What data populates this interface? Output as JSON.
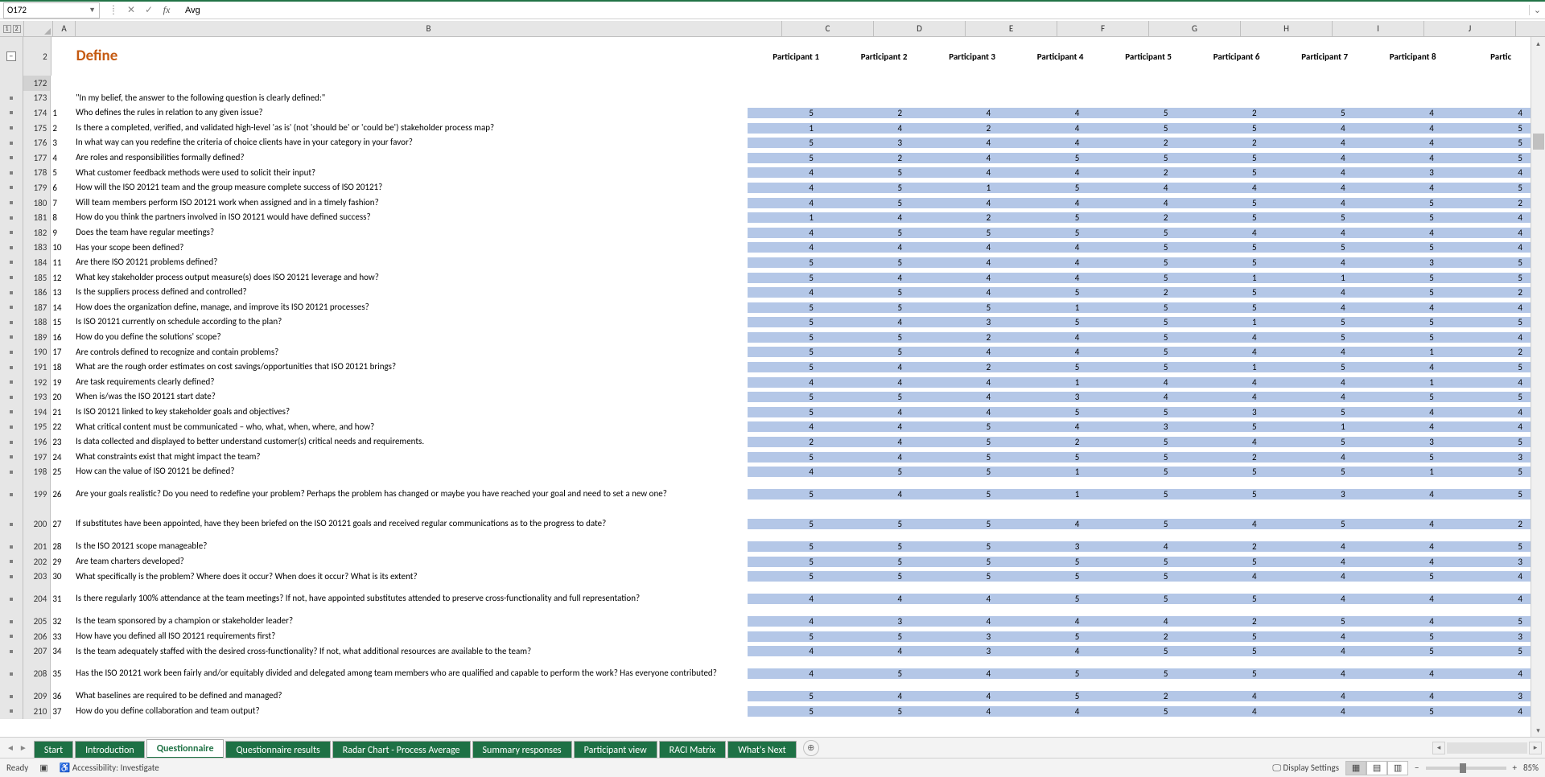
{
  "formula_bar": {
    "namebox": "O172",
    "formula": "Avg"
  },
  "outline_levels": [
    "1",
    "2"
  ],
  "columns": [
    "A",
    "B",
    "C",
    "D",
    "E",
    "F",
    "G",
    "H",
    "I",
    "J"
  ],
  "title_row": {
    "row_num": "2",
    "title": "Define",
    "participants": [
      "Participant 1",
      "Participant 2",
      "Participant 3",
      "Participant 4",
      "Participant 5",
      "Participant 6",
      "Participant 7",
      "Participant 8",
      "Partic"
    ]
  },
  "selected_row_num": "172",
  "intro_row": {
    "row_num": "173",
    "text": "\"In my belief, the answer to the following question is clearly defined:\""
  },
  "rows": [
    {
      "r": "174",
      "n": "1",
      "q": "Who defines the rules in relation to any given issue?",
      "v": [
        "5",
        "2",
        "4",
        "4",
        "5",
        "2",
        "5",
        "4",
        "4"
      ]
    },
    {
      "r": "175",
      "n": "2",
      "q": "Is there a completed, verified, and validated high-level 'as is' (not 'should be' or 'could be') stakeholder process map?",
      "v": [
        "1",
        "4",
        "2",
        "4",
        "5",
        "5",
        "4",
        "4",
        "5"
      ]
    },
    {
      "r": "176",
      "n": "3",
      "q": "In what way can you redefine the criteria of choice clients have in your category in your favor?",
      "v": [
        "5",
        "3",
        "4",
        "4",
        "2",
        "2",
        "4",
        "4",
        "5"
      ]
    },
    {
      "r": "177",
      "n": "4",
      "q": "Are roles and responsibilities formally defined?",
      "v": [
        "5",
        "2",
        "4",
        "5",
        "5",
        "5",
        "4",
        "4",
        "5"
      ]
    },
    {
      "r": "178",
      "n": "5",
      "q": "What customer feedback methods were used to solicit their input?",
      "v": [
        "4",
        "5",
        "4",
        "4",
        "2",
        "5",
        "4",
        "3",
        "4"
      ]
    },
    {
      "r": "179",
      "n": "6",
      "q": "How will the ISO 20121 team and the group measure complete success of ISO 20121?",
      "v": [
        "4",
        "5",
        "1",
        "5",
        "4",
        "4",
        "4",
        "4",
        "5"
      ]
    },
    {
      "r": "180",
      "n": "7",
      "q": "Will team members perform ISO 20121 work when assigned and in a timely fashion?",
      "v": [
        "4",
        "5",
        "4",
        "4",
        "4",
        "5",
        "4",
        "5",
        "2"
      ]
    },
    {
      "r": "181",
      "n": "8",
      "q": "How do you think the partners involved in ISO 20121 would have defined success?",
      "v": [
        "1",
        "4",
        "2",
        "5",
        "2",
        "5",
        "5",
        "5",
        "4"
      ]
    },
    {
      "r": "182",
      "n": "9",
      "q": "Does the team have regular meetings?",
      "v": [
        "4",
        "5",
        "5",
        "5",
        "5",
        "4",
        "4",
        "4",
        "4"
      ]
    },
    {
      "r": "183",
      "n": "10",
      "q": "Has your scope been defined?",
      "v": [
        "4",
        "4",
        "4",
        "4",
        "5",
        "5",
        "5",
        "5",
        "4"
      ]
    },
    {
      "r": "184",
      "n": "11",
      "q": "Are there ISO 20121 problems defined?",
      "v": [
        "5",
        "5",
        "4",
        "4",
        "5",
        "5",
        "4",
        "3",
        "5"
      ]
    },
    {
      "r": "185",
      "n": "12",
      "q": "What key stakeholder process output measure(s) does ISO 20121 leverage and how?",
      "v": [
        "5",
        "4",
        "4",
        "4",
        "5",
        "1",
        "1",
        "5",
        "5"
      ]
    },
    {
      "r": "186",
      "n": "13",
      "q": "Is the suppliers process defined and controlled?",
      "v": [
        "4",
        "5",
        "4",
        "5",
        "2",
        "5",
        "4",
        "5",
        "2"
      ]
    },
    {
      "r": "187",
      "n": "14",
      "q": "How does the organization define, manage, and improve its ISO 20121 processes?",
      "v": [
        "5",
        "5",
        "5",
        "1",
        "5",
        "5",
        "4",
        "4",
        "4"
      ]
    },
    {
      "r": "188",
      "n": "15",
      "q": "Is ISO 20121 currently on schedule according to the plan?",
      "v": [
        "5",
        "4",
        "3",
        "5",
        "5",
        "1",
        "5",
        "5",
        "5"
      ]
    },
    {
      "r": "189",
      "n": "16",
      "q": "How do you define the solutions' scope?",
      "v": [
        "5",
        "5",
        "2",
        "4",
        "5",
        "4",
        "5",
        "5",
        "4"
      ]
    },
    {
      "r": "190",
      "n": "17",
      "q": "Are controls defined to recognize and contain problems?",
      "v": [
        "5",
        "5",
        "4",
        "4",
        "5",
        "4",
        "4",
        "1",
        "2"
      ]
    },
    {
      "r": "191",
      "n": "18",
      "q": "What are the rough order estimates on cost savings/opportunities that ISO 20121 brings?",
      "v": [
        "5",
        "4",
        "2",
        "5",
        "5",
        "1",
        "5",
        "4",
        "5"
      ]
    },
    {
      "r": "192",
      "n": "19",
      "q": "Are task requirements clearly defined?",
      "v": [
        "4",
        "4",
        "4",
        "1",
        "4",
        "4",
        "4",
        "1",
        "4"
      ]
    },
    {
      "r": "193",
      "n": "20",
      "q": "When is/was the ISO 20121 start date?",
      "v": [
        "5",
        "5",
        "4",
        "3",
        "4",
        "4",
        "4",
        "5",
        "5"
      ]
    },
    {
      "r": "194",
      "n": "21",
      "q": "Is ISO 20121 linked to key stakeholder goals and objectives?",
      "v": [
        "5",
        "4",
        "4",
        "5",
        "5",
        "3",
        "5",
        "4",
        "4"
      ]
    },
    {
      "r": "195",
      "n": "22",
      "q": "What critical content must be communicated – who, what, when, where, and how?",
      "v": [
        "4",
        "4",
        "5",
        "4",
        "3",
        "5",
        "1",
        "4",
        "4"
      ]
    },
    {
      "r": "196",
      "n": "23",
      "q": "Is data collected and displayed to better understand customer(s) critical needs and requirements.",
      "v": [
        "2",
        "4",
        "5",
        "2",
        "5",
        "4",
        "5",
        "3",
        "5"
      ]
    },
    {
      "r": "197",
      "n": "24",
      "q": "What constraints exist that might impact the team?",
      "v": [
        "5",
        "4",
        "5",
        "5",
        "5",
        "2",
        "4",
        "5",
        "3"
      ]
    },
    {
      "r": "198",
      "n": "25",
      "q": "How can the value of ISO 20121 be defined?",
      "v": [
        "4",
        "5",
        "5",
        "1",
        "5",
        "5",
        "5",
        "1",
        "5"
      ]
    },
    {
      "r": "199",
      "n": "26",
      "tall": true,
      "q": "Are your goals realistic? Do you need to redefine your problem? Perhaps the problem has changed or maybe you have reached your goal and need to set a new one?",
      "v": [
        "5",
        "4",
        "5",
        "1",
        "5",
        "5",
        "3",
        "4",
        "5"
      ]
    },
    {
      "r": "200",
      "n": "27",
      "tall": true,
      "q": "If substitutes have been appointed, have they been briefed on the ISO 20121 goals and received regular communications as to the progress to date?",
      "v": [
        "5",
        "5",
        "5",
        "4",
        "5",
        "4",
        "5",
        "4",
        "2"
      ]
    },
    {
      "r": "201",
      "n": "28",
      "q": "Is the ISO 20121 scope manageable?",
      "v": [
        "5",
        "5",
        "5",
        "3",
        "4",
        "2",
        "4",
        "4",
        "5"
      ]
    },
    {
      "r": "202",
      "n": "29",
      "q": "Are team charters developed?",
      "v": [
        "5",
        "5",
        "5",
        "5",
        "5",
        "5",
        "4",
        "4",
        "3"
      ]
    },
    {
      "r": "203",
      "n": "30",
      "q": "What specifically is the problem? Where does it occur? When does it occur? What is its extent?",
      "v": [
        "5",
        "5",
        "5",
        "5",
        "5",
        "4",
        "4",
        "5",
        "4"
      ]
    },
    {
      "r": "204",
      "n": "31",
      "tall": true,
      "q": "Is there regularly 100% attendance at the team meetings? If not, have appointed substitutes attended to preserve cross-functionality and full representation?",
      "v": [
        "4",
        "4",
        "4",
        "5",
        "5",
        "5",
        "4",
        "4",
        "4"
      ]
    },
    {
      "r": "205",
      "n": "32",
      "q": "Is the team sponsored by a champion or stakeholder leader?",
      "v": [
        "4",
        "3",
        "4",
        "4",
        "4",
        "2",
        "5",
        "4",
        "5"
      ]
    },
    {
      "r": "206",
      "n": "33",
      "q": "How have you defined all ISO 20121 requirements first?",
      "v": [
        "5",
        "5",
        "3",
        "5",
        "2",
        "5",
        "4",
        "5",
        "3"
      ]
    },
    {
      "r": "207",
      "n": "34",
      "q": "Is the team adequately staffed with the desired cross-functionality? If not, what additional resources are available to the team?",
      "v": [
        "4",
        "4",
        "3",
        "4",
        "5",
        "5",
        "4",
        "5",
        "5"
      ]
    },
    {
      "r": "208",
      "n": "35",
      "tall": true,
      "q": "Has the ISO 20121 work been fairly and/or equitably divided and delegated among team members who are qualified and capable to perform the work? Has everyone contributed?",
      "v": [
        "4",
        "5",
        "4",
        "5",
        "5",
        "5",
        "4",
        "4",
        "4"
      ]
    },
    {
      "r": "209",
      "n": "36",
      "q": "What baselines are required to be defined and managed?",
      "v": [
        "5",
        "4",
        "4",
        "5",
        "2",
        "4",
        "4",
        "4",
        "3"
      ]
    },
    {
      "r": "210",
      "n": "37",
      "q": "How do you define collaboration and team output?",
      "v": [
        "5",
        "5",
        "4",
        "4",
        "5",
        "4",
        "4",
        "5",
        "4"
      ]
    }
  ],
  "tabs": [
    {
      "label": "Start",
      "active": false
    },
    {
      "label": "Introduction",
      "active": false
    },
    {
      "label": "Questionnaire",
      "active": true
    },
    {
      "label": "Questionnaire results",
      "active": false
    },
    {
      "label": "Radar Chart - Process Average",
      "active": false
    },
    {
      "label": "Summary responses",
      "active": false
    },
    {
      "label": "Participant view",
      "active": false
    },
    {
      "label": "RACI Matrix",
      "active": false
    },
    {
      "label": "What's Next",
      "active": false
    }
  ],
  "status": {
    "ready": "Ready",
    "accessibility": "Accessibility: Investigate",
    "display_settings": "Display Settings",
    "zoom": "85%"
  }
}
